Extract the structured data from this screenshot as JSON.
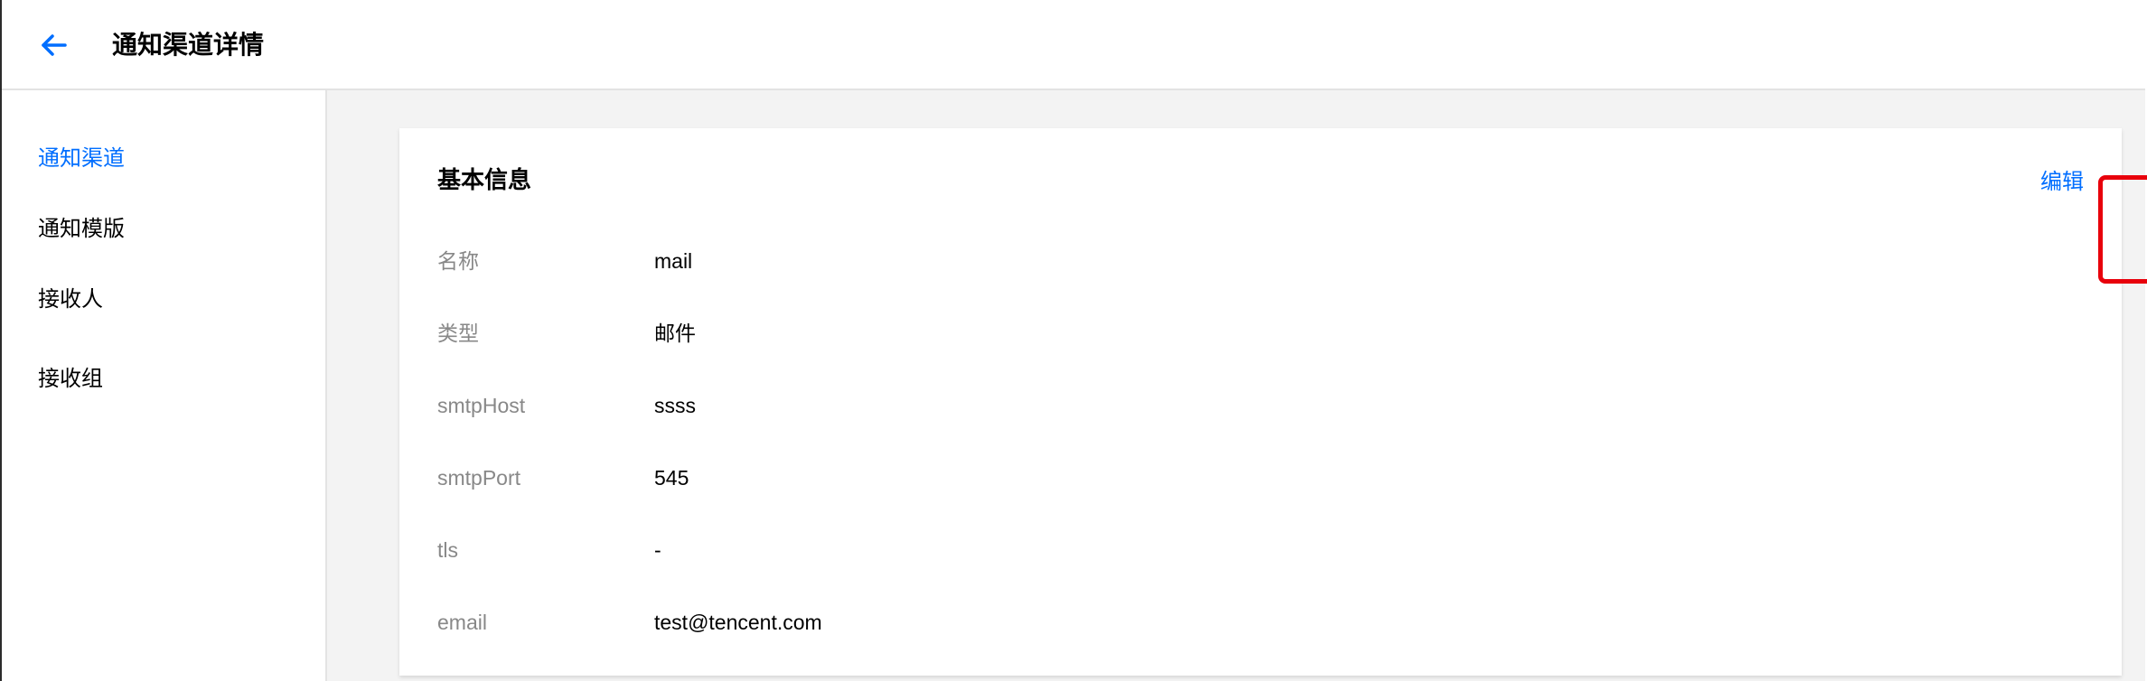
{
  "header": {
    "back_icon": "arrow-left-icon",
    "title": "通知渠道详情"
  },
  "sidebar": {
    "items": [
      {
        "label": "通知渠道",
        "active": true
      },
      {
        "label": "通知模版",
        "active": false
      },
      {
        "label": "接收人",
        "active": false
      },
      {
        "label": "接收组",
        "active": false
      }
    ]
  },
  "card": {
    "title": "基本信息",
    "edit_label": "编辑",
    "rows": [
      {
        "label": "名称",
        "value": "mail"
      },
      {
        "label": "类型",
        "value": "邮件"
      },
      {
        "label": "smtpHost",
        "value": "ssss"
      },
      {
        "label": "smtpPort",
        "value": "545"
      },
      {
        "label": "tls",
        "value": "-"
      },
      {
        "label": "email",
        "value": "test@tencent.com"
      }
    ]
  },
  "colors": {
    "accent": "#006eff",
    "highlight": "#e8000b",
    "label_gray": "#888888",
    "background": "#f3f3f3"
  }
}
